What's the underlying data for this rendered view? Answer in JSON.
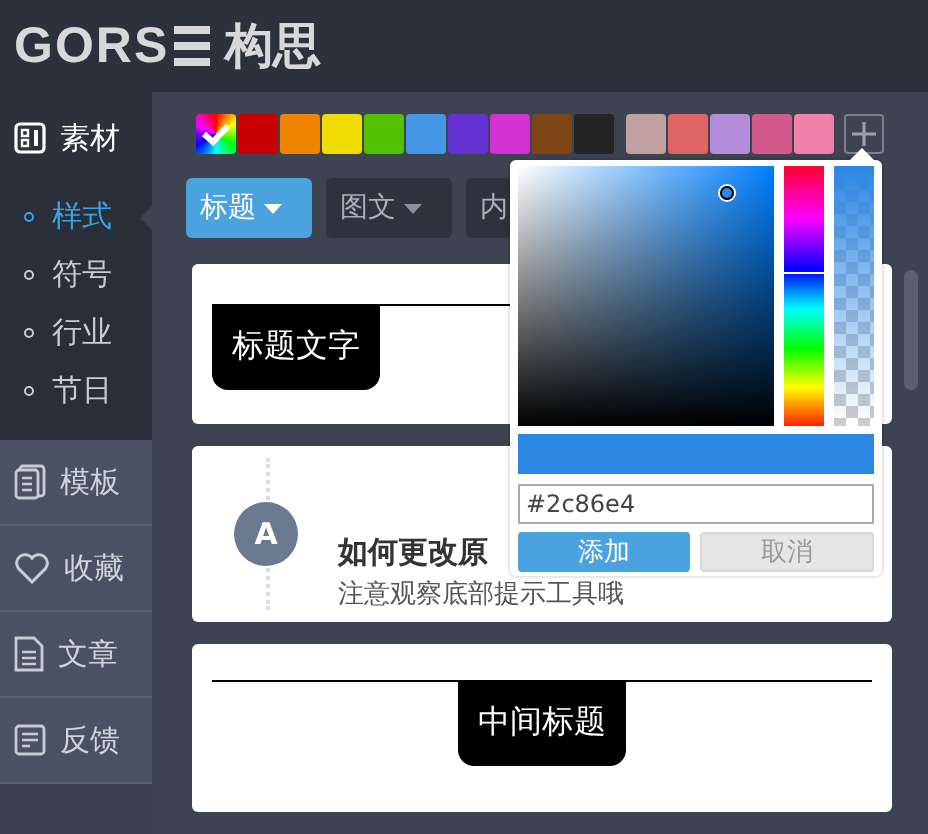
{
  "header": {
    "logo_text": "GORS",
    "logo_cn": "构思"
  },
  "sidebar": {
    "items": [
      {
        "label": "素材",
        "expanded": true,
        "children": [
          {
            "label": "样式",
            "selected": true
          },
          {
            "label": "符号",
            "selected": false
          },
          {
            "label": "行业",
            "selected": false
          },
          {
            "label": "节日",
            "selected": false
          }
        ]
      },
      {
        "label": "模板",
        "expanded": false
      },
      {
        "label": "收藏",
        "expanded": false
      },
      {
        "label": "文章",
        "expanded": false
      },
      {
        "label": "反馈",
        "expanded": false
      }
    ]
  },
  "palette": [
    {
      "kind": "rainbow",
      "selected": true
    },
    {
      "kind": "solid",
      "color": "#c80000",
      "selected": false
    },
    {
      "kind": "solid",
      "color": "#f08300",
      "selected": false
    },
    {
      "kind": "solid",
      "color": "#f0dc00",
      "selected": false
    },
    {
      "kind": "solid",
      "color": "#50c000",
      "selected": false
    },
    {
      "kind": "solid",
      "color": "#4696e6",
      "selected": false
    },
    {
      "kind": "solid",
      "color": "#6432d2",
      "selected": false
    },
    {
      "kind": "solid",
      "color": "#d232d2",
      "selected": false
    },
    {
      "kind": "solid",
      "color": "#7d4614",
      "selected": false
    },
    {
      "kind": "solid",
      "color": "#232323",
      "selected": false
    }
  ],
  "custom_colors": [
    {
      "color": "#c0a0a0",
      "selected": false
    },
    {
      "color": "#e06464",
      "selected": false
    },
    {
      "color": "#b48cdc",
      "selected": false
    },
    {
      "color": "#d25a8c",
      "selected": false
    },
    {
      "color": "#f082aa",
      "selected": false
    }
  ],
  "tabs": [
    {
      "label": "标题",
      "selected": true
    },
    {
      "label": "图文",
      "selected": false
    },
    {
      "label": "内",
      "selected": false
    }
  ],
  "cards": [
    {
      "kind": "title-tab",
      "text": "标题文字"
    },
    {
      "kind": "timeline",
      "badge": "A",
      "title": "如何更改原",
      "subtitle": "注意观察底部提示工具哦"
    },
    {
      "kind": "center-title",
      "text": "中间标题"
    }
  ],
  "color_picker": {
    "open": true,
    "value": "#2c86e4",
    "confirm": "添加",
    "cancel": "取消"
  }
}
